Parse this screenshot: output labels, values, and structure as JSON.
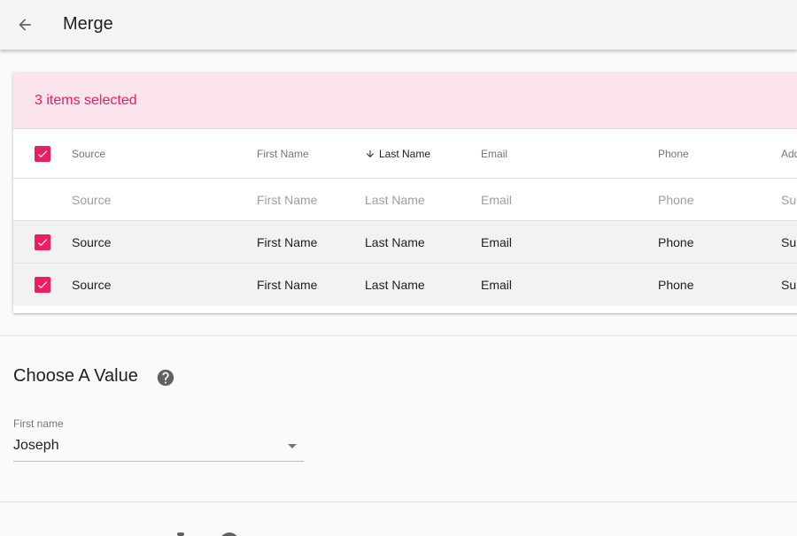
{
  "appbar": {
    "title": "Merge",
    "back_icon": "arrow-back-icon"
  },
  "selection": {
    "text": "3 items selected"
  },
  "table": {
    "headers": {
      "source": "Source",
      "first_name": "First Name",
      "last_name": "Last Name",
      "email": "Email",
      "phone": "Phone",
      "address": "Add"
    },
    "sorted_column": "Last Name",
    "filter": {
      "source": "Source",
      "first_name": "First Name",
      "last_name": "Last Name",
      "email": "Email",
      "phone": "Phone",
      "address": "Sup"
    },
    "rows": [
      {
        "source": "Source",
        "first_name": "First Name",
        "last_name": "Last Name",
        "email": "Email",
        "phone": "Phone",
        "address": "Sup"
      },
      {
        "source": "Source",
        "first_name": "First Name",
        "last_name": "Last Name",
        "email": "Email",
        "phone": "Phone",
        "address": "Sup"
      }
    ]
  },
  "choose_value": {
    "title": "Choose A Value",
    "help_icon": "help-icon",
    "field": {
      "label": "First name",
      "value": "Joseph"
    }
  },
  "colors": {
    "accent": "#e91e63",
    "selection_bg": "#fce4ec",
    "appbar_bg": "#f5f5f5"
  }
}
